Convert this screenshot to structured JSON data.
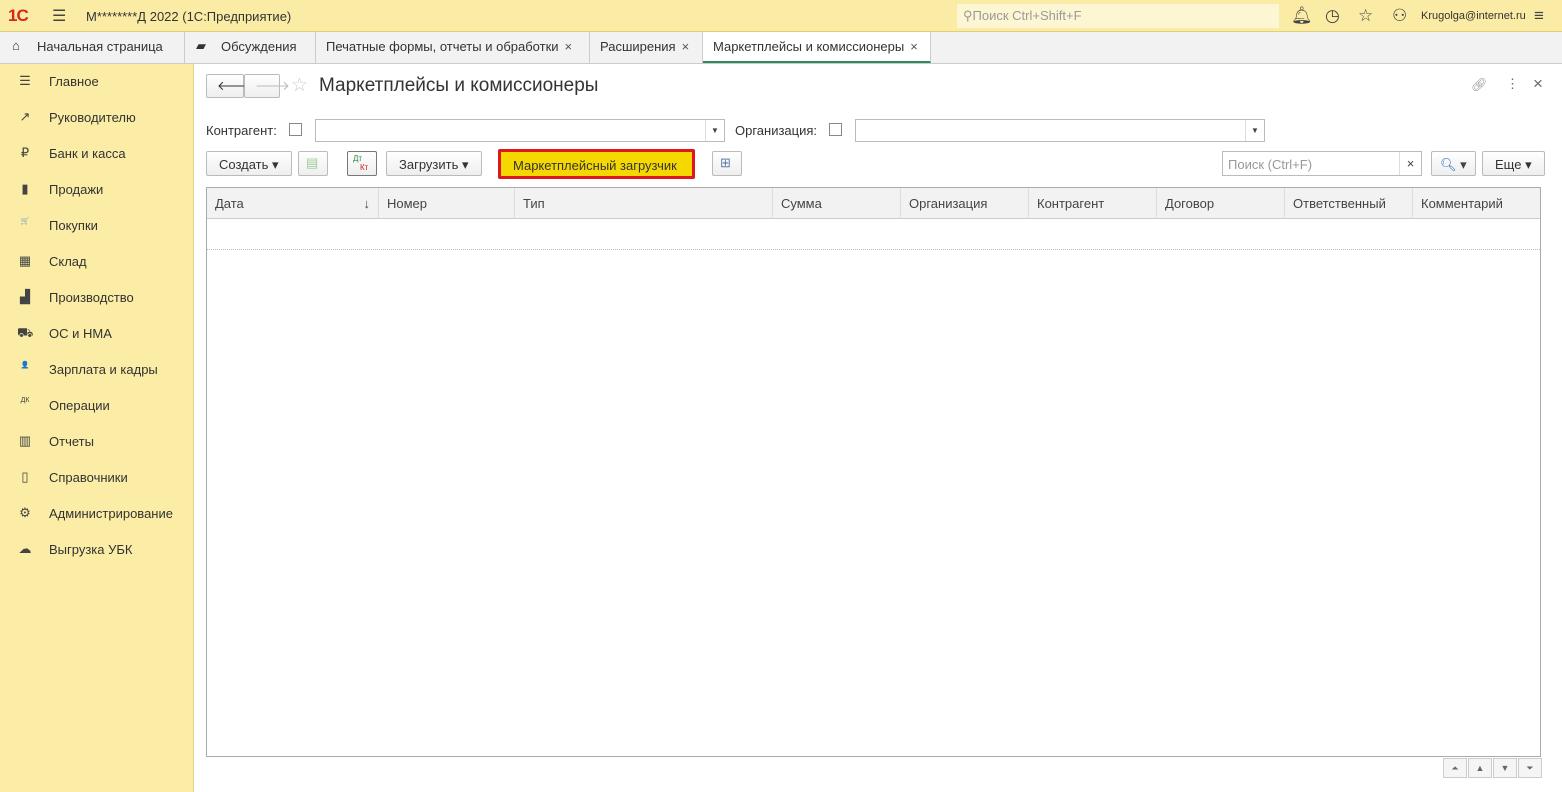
{
  "app": {
    "logo": "1С",
    "title": "М********Д 2022  (1С:Предприятие)",
    "search_placeholder": "Поиск Ctrl+Shift+F",
    "user": "Krugolga@internet.ru"
  },
  "tabs": [
    {
      "label": "Начальная страница"
    },
    {
      "label": "Обсуждения"
    },
    {
      "label": "Печатные формы, отчеты и обработки"
    },
    {
      "label": "Расширения"
    },
    {
      "label": "Маркетплейсы и комиссионеры",
      "active": true
    }
  ],
  "sidebar": [
    {
      "label": "Главное",
      "icon": "☰"
    },
    {
      "label": "Руководителю",
      "icon": "↗"
    },
    {
      "label": "Банк и касса",
      "icon": "₽"
    },
    {
      "label": "Продажи",
      "icon": "▮"
    },
    {
      "label": "Покупки",
      "icon": "🛒"
    },
    {
      "label": "Склад",
      "icon": "▦"
    },
    {
      "label": "Производство",
      "icon": "▟"
    },
    {
      "label": "ОС и НМА",
      "icon": "⛟"
    },
    {
      "label": "Зарплата и кадры",
      "icon": "👤"
    },
    {
      "label": "Операции",
      "icon": "ДК"
    },
    {
      "label": "Отчеты",
      "icon": "▥"
    },
    {
      "label": "Справочники",
      "icon": "▯"
    },
    {
      "label": "Администрирование",
      "icon": "⚙"
    },
    {
      "label": "Выгрузка УБК",
      "icon": "☁"
    }
  ],
  "form": {
    "title": "Маркетплейсы и комиссионеры",
    "kontragent_label": "Контрагент:",
    "org_label": "Организация:",
    "create": "Создать",
    "dtkt_top": "Дт",
    "dtkt_bottom": "Кт",
    "load": "Загрузить",
    "marketplace_loader": "Маркетплейсный загрузчик",
    "search_placeholder": "Поиск (Ctrl+F)",
    "more": "Еще"
  },
  "columns": [
    "Дата",
    "Номер",
    "Тип",
    "Сумма",
    "Организация",
    "Контрагент",
    "Договор",
    "Ответственный",
    "Комментарий"
  ],
  "colors": {
    "accent": "#fbeca5",
    "highlight": "#f5d800",
    "highlight_border": "#e0161b"
  }
}
